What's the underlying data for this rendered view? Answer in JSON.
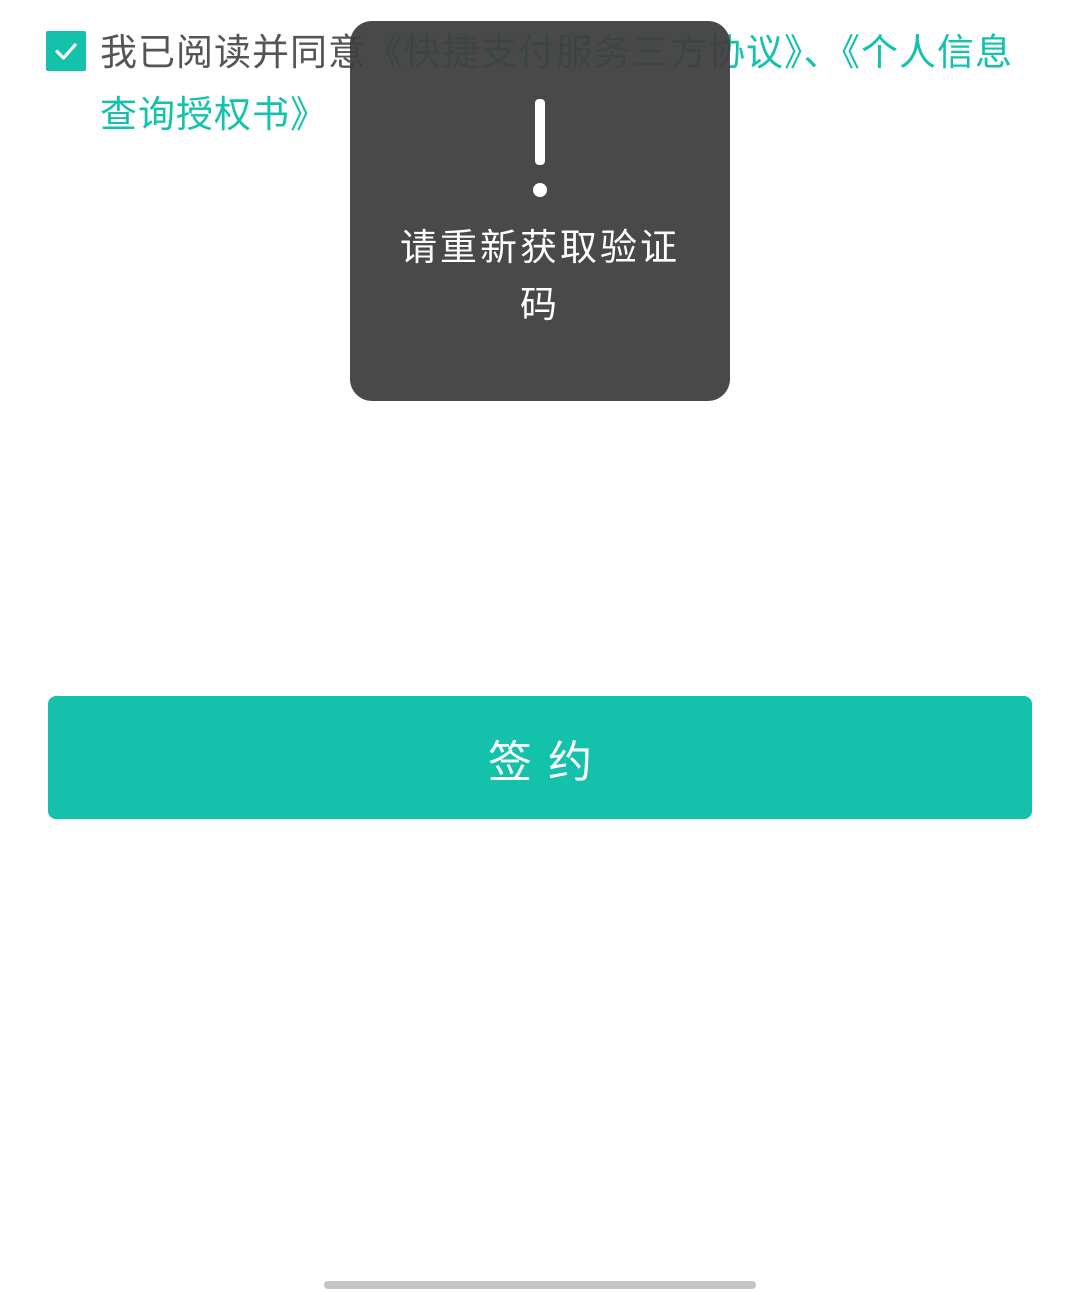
{
  "colors": {
    "accent": "#14c1ab",
    "text": "#555555",
    "toast_bg": "#3e3e3e",
    "home_indicator": "#c4c4c4"
  },
  "agreement": {
    "checked": true,
    "prefix": "我已阅读并同意",
    "link1": "《快捷支付服务三方协议》",
    "separator": "、",
    "link2": "《个人信息查询授权书》"
  },
  "toast": {
    "icon": "exclamation-icon",
    "message": "请重新获取验证码"
  },
  "sign_button": {
    "label": "签约"
  }
}
